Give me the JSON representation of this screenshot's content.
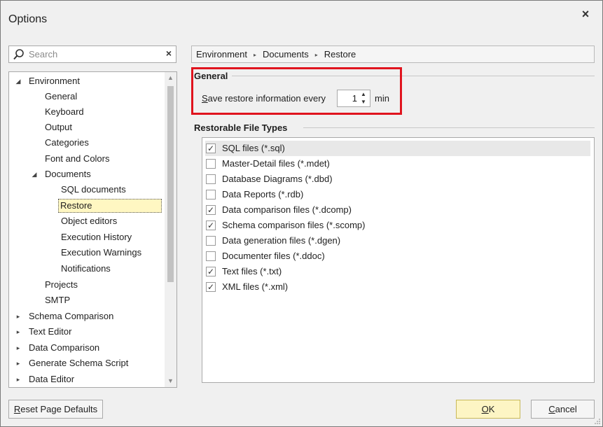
{
  "window": {
    "title": "Options",
    "close_label": "×"
  },
  "search": {
    "placeholder": "Search",
    "value": "",
    "clear_label": "×"
  },
  "tree": {
    "items": [
      {
        "label": "Environment",
        "expander": "◢"
      },
      {
        "label": "General"
      },
      {
        "label": "Keyboard"
      },
      {
        "label": "Output"
      },
      {
        "label": "Categories"
      },
      {
        "label": "Font and Colors"
      },
      {
        "label": "Documents",
        "expander": "◢"
      },
      {
        "label": "SQL documents"
      },
      {
        "label": "Restore",
        "selected": true
      },
      {
        "label": "Object editors"
      },
      {
        "label": "Execution History"
      },
      {
        "label": "Execution Warnings"
      },
      {
        "label": "Notifications"
      },
      {
        "label": "Projects"
      },
      {
        "label": "SMTP"
      },
      {
        "label": "Schema Comparison",
        "expander": "▸"
      },
      {
        "label": "Text Editor",
        "expander": "▸"
      },
      {
        "label": "Data Comparison",
        "expander": "▸"
      },
      {
        "label": "Generate Schema Script",
        "expander": "▸"
      },
      {
        "label": "Data Editor",
        "expander": "▸"
      }
    ],
    "scroll_up": "▲",
    "scroll_down": "▼"
  },
  "breadcrumb": {
    "items": [
      "Environment",
      "Documents",
      "Restore"
    ],
    "separator": "▸"
  },
  "general": {
    "title": "General",
    "restore_label_accel": "S",
    "restore_label_rest": "ave restore information every",
    "interval_value": "1",
    "interval_unit": "min",
    "spin_up": "▲",
    "spin_down": "▼"
  },
  "file_types": {
    "title": "Restorable File Types",
    "check_mark": "✓",
    "items": [
      {
        "label": "SQL files (*.sql)",
        "checked": true
      },
      {
        "label": "Master-Detail files (*.mdet)",
        "checked": false
      },
      {
        "label": "Database Diagrams (*.dbd)",
        "checked": false
      },
      {
        "label": "Data Reports (*.rdb)",
        "checked": false
      },
      {
        "label": "Data comparison files (*.dcomp)",
        "checked": true
      },
      {
        "label": "Schema comparison files (*.scomp)",
        "checked": true
      },
      {
        "label": "Data generation files (*.dgen)",
        "checked": false
      },
      {
        "label": "Documenter files (*.ddoc)",
        "checked": false
      },
      {
        "label": "Text files (*.txt)",
        "checked": true
      },
      {
        "label": "XML files (*.xml)",
        "checked": true
      }
    ]
  },
  "footer": {
    "reset_accel": "R",
    "reset_rest": "eset Page Defaults",
    "ok_accel": "O",
    "ok_rest": "K",
    "cancel_accel": "C",
    "cancel_rest": "ancel"
  },
  "colors": {
    "highlight": "#e0141e",
    "selected_bg": "#fff7c2",
    "ok_bg": "#fdf5c4"
  }
}
